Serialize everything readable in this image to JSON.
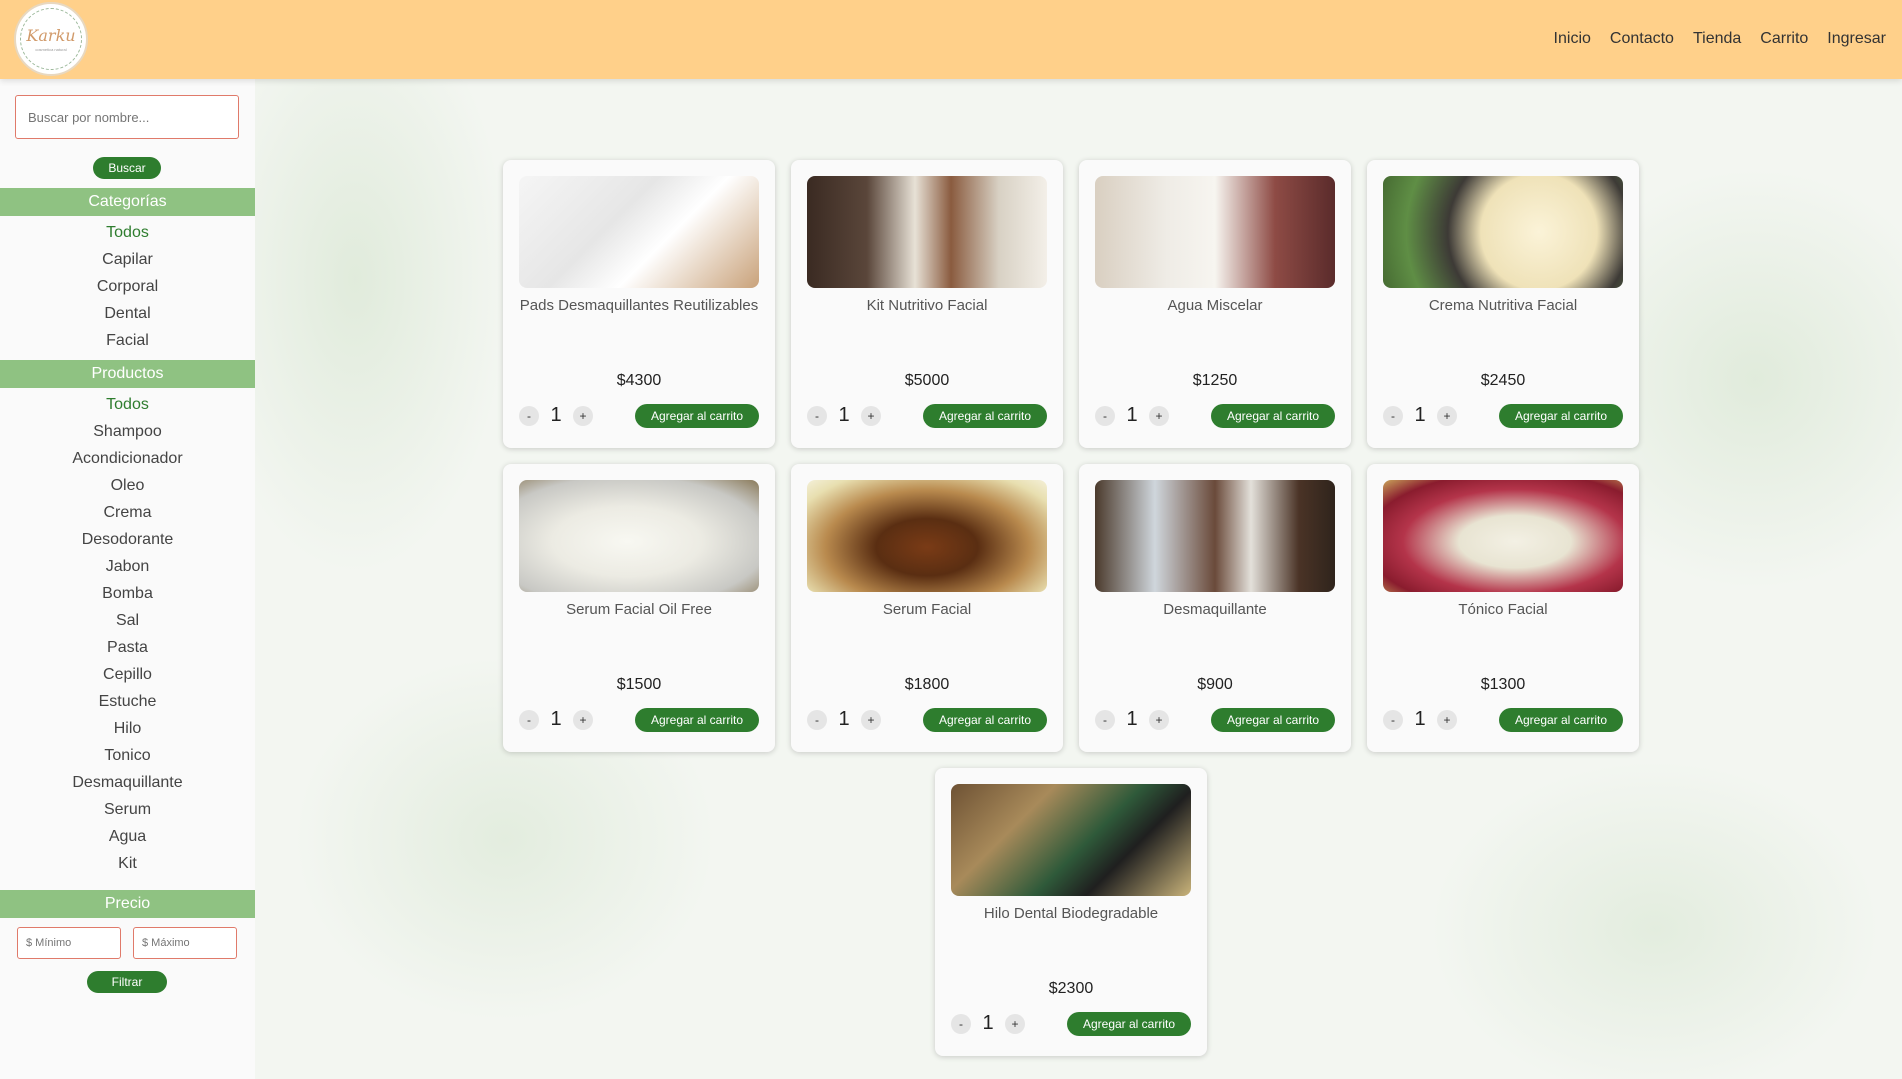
{
  "brand": {
    "logo_text": "Karku",
    "logo_sub": "cosmetica natural"
  },
  "nav": [
    "Inicio",
    "Contacto",
    "Tienda",
    "Carrito",
    "Ingresar"
  ],
  "search": {
    "placeholder": "Buscar por nombre...",
    "button": "Buscar"
  },
  "categories": {
    "title": "Categorías",
    "items": [
      "Todos",
      "Capilar",
      "Corporal",
      "Dental",
      "Facial"
    ]
  },
  "products_filter": {
    "title": "Productos",
    "items": [
      "Todos",
      "Shampoo",
      "Acondicionador",
      "Oleo",
      "Crema",
      "Desodorante",
      "Jabon",
      "Bomba",
      "Sal",
      "Pasta",
      "Cepillo",
      "Estuche",
      "Hilo",
      "Tonico",
      "Desmaquillante",
      "Serum",
      "Agua",
      "Kit"
    ]
  },
  "price": {
    "title": "Precio",
    "min_placeholder": "$ Mínimo",
    "max_placeholder": "$ Máximo",
    "button": "Filtrar"
  },
  "cart_button": "Agregar al carrito",
  "products": [
    {
      "name": "Pads Desmaquillantes Reutilizables",
      "price": "$4300",
      "qty": "1",
      "minus": "-",
      "plus": "+"
    },
    {
      "name": "Kit Nutritivo Facial",
      "price": "$5000",
      "qty": "1",
      "minus": "-",
      "plus": "+"
    },
    {
      "name": "Agua Miscelar",
      "price": "$1250",
      "qty": "1",
      "minus": "-",
      "plus": "+"
    },
    {
      "name": "Crema Nutritiva Facial",
      "price": "$2450",
      "qty": "1",
      "minus": "-",
      "plus": "+"
    },
    {
      "name": "Serum Facial Oil Free",
      "price": "$1500",
      "qty": "1",
      "minus": "-",
      "plus": "+"
    },
    {
      "name": "Serum Facial",
      "price": "$1800",
      "qty": "1",
      "minus": "-",
      "plus": "+"
    },
    {
      "name": "Desmaquillante",
      "price": "$900",
      "qty": "1",
      "minus": "-",
      "plus": "+"
    },
    {
      "name": "Tónico Facial",
      "price": "$1300",
      "qty": "1",
      "minus": "-",
      "plus": "+"
    },
    {
      "name": "Hilo Dental Biodegradable",
      "price": "$2300",
      "qty": "1",
      "minus": "-",
      "plus": "+"
    }
  ],
  "colors": {
    "header": "#ffd08a",
    "accent_green": "#2e7d2e",
    "section_green": "#8fc282",
    "input_border": "#e07a6a"
  }
}
